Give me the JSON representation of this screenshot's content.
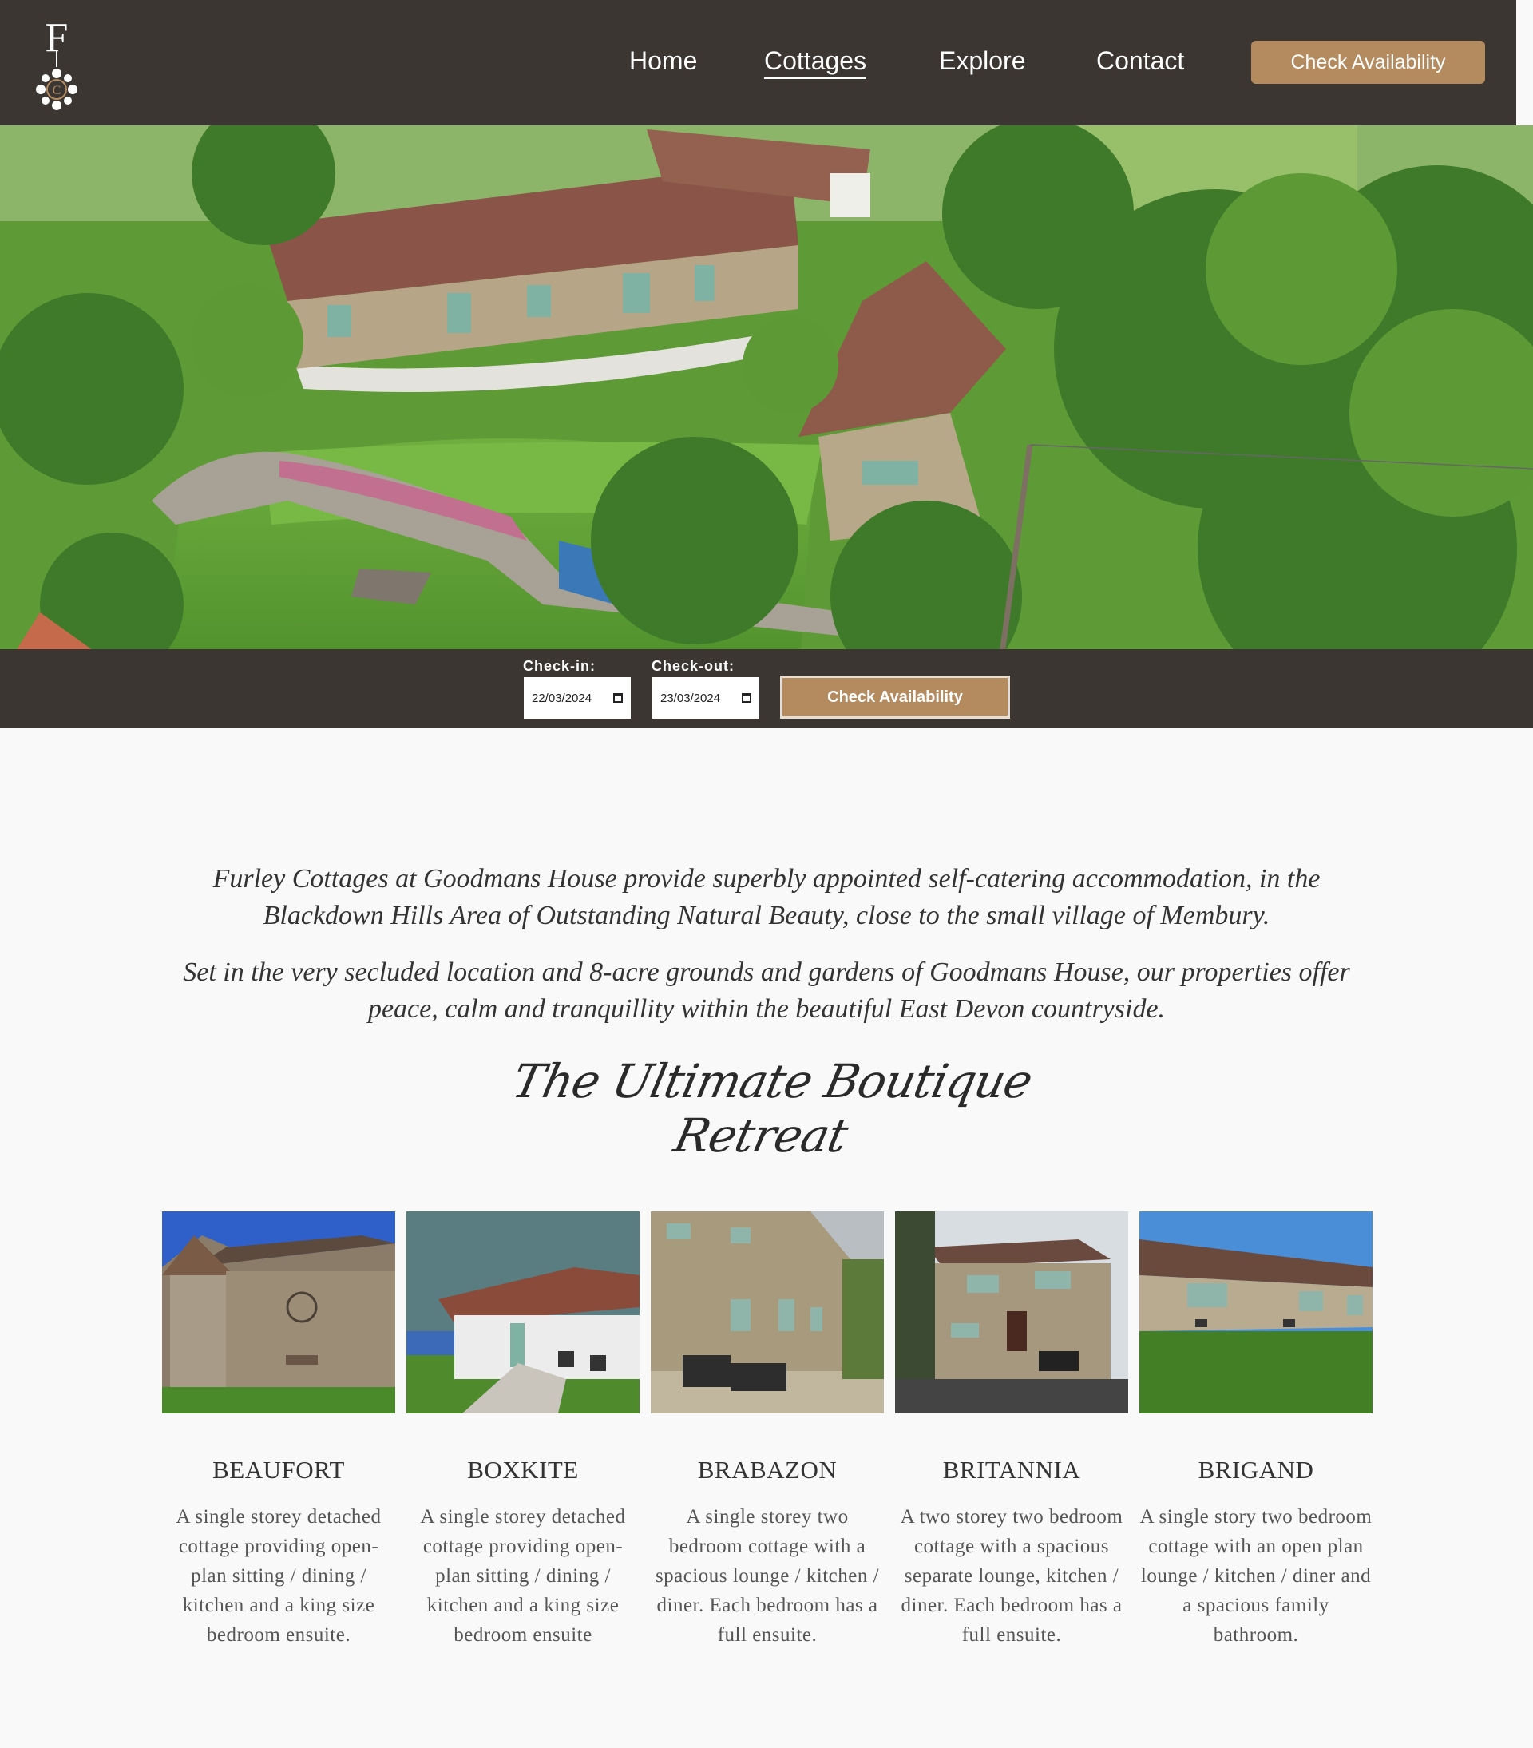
{
  "nav": {
    "logo_letter": "F",
    "links": [
      {
        "label": "Home"
      },
      {
        "label": "Cottages",
        "active": true
      },
      {
        "label": "Explore"
      },
      {
        "label": "Contact"
      }
    ],
    "cta_label": "Check Availability"
  },
  "booking": {
    "checkin_label": "Check-in:",
    "checkin_value": "22/03/2024",
    "checkout_label": "Check-out:",
    "checkout_value": "23/03/2024",
    "button_label": "Check Availability"
  },
  "intro": {
    "paragraph1": "Furley Cottages at Goodmans House provide superbly appointed self-catering accommodation, in the Blackdown Hills Area of Outstanding Natural Beauty, close to the small village of Membury.",
    "paragraph2": "Set in the very secluded location and 8-acre grounds and gardens of Goodmans House, our properties offer peace, calm and tranquillity within the beautiful East Devon countryside.",
    "tagline": "The Ultimate Boutique Retreat"
  },
  "cottages": [
    {
      "name": "BEAUFORT",
      "description": "A single storey detached cottage providing open-plan sitting / dining / kitchen and a king size bedroom ensuite."
    },
    {
      "name": "BOXKITE",
      "description": "A single storey detached cottage providing open-plan sitting / dining / kitchen and a king size bedroom ensuite"
    },
    {
      "name": "BRABAZON",
      "description": "A single storey two bedroom cottage with a spacious lounge / kitchen / diner. Each bedroom has a full ensuite."
    },
    {
      "name": "BRITANNIA",
      "description": "A two storey two bedroom cottage with a spacious separate lounge, kitchen / diner. Each bedroom has a full ensuite."
    },
    {
      "name": "BRIGAND",
      "description": "A single story two bedroom cottage with an open plan lounge / kitchen / diner and a spacious family bathroom."
    }
  ],
  "colors": {
    "nav_bg": "#3b3632",
    "accent": "#b48a5f",
    "page_bg": "#f9f9f9"
  }
}
